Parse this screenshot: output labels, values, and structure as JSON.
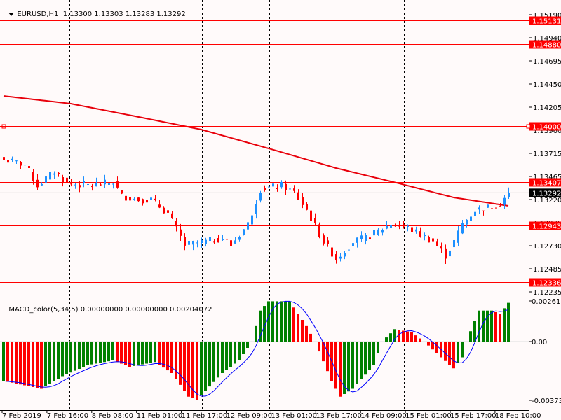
{
  "header": {
    "symbol": "EURUSD,H1",
    "open": "1.13300",
    "high": "1.13303",
    "low": "1.13283",
    "close": "1.13292"
  },
  "indicator": {
    "name": "MACD_color(5,34,5)",
    "v1": "0.00000000",
    "v2": "0.00000000",
    "v3": "0.00204072",
    "axis_top": "0.0026192",
    "axis_zero": "0.00",
    "axis_bottom": "-0.003734"
  },
  "price_axis": [
    "1.15190",
    "1.14940",
    "1.14695",
    "1.14450",
    "1.14205",
    "1.13960",
    "1.13715",
    "1.13465",
    "1.13220",
    "1.12975",
    "1.12730",
    "1.12485",
    "1.12235"
  ],
  "levels": [
    {
      "label": "1.15131",
      "value": 1.15131
    },
    {
      "label": "1.14880",
      "value": 1.1488
    },
    {
      "label": "1.14000",
      "value": 1.14
    },
    {
      "label": "1.13407",
      "value": 1.13407
    },
    {
      "label": "1.12943",
      "value": 1.12943
    },
    {
      "label": "1.12336",
      "value": 1.12336
    }
  ],
  "current_price": {
    "label": "1.13292",
    "value": 1.13292
  },
  "time_axis": [
    "7 Feb 2019",
    "7 Feb 16:00",
    "8 Feb 08:00",
    "11 Feb 01:00",
    "11 Feb 17:00",
    "12 Feb 09:00",
    "13 Feb 01:00",
    "13 Feb 17:00",
    "14 Feb 09:00",
    "15 Feb 01:00",
    "15 Feb 17:00",
    "18 Feb 10:00"
  ],
  "colors": {
    "bull": "#1e90ff",
    "bear": "#ff0000",
    "ma": "#e8000b",
    "level": "#ff0000",
    "macd_up": "#008000",
    "macd_down": "#ff0000",
    "signal": "#0000ff",
    "bg": "#fffafa"
  },
  "chart_data": {
    "type": "candlestick",
    "bars": 121,
    "price_range": [
      1.12235,
      1.1519
    ],
    "close_anchors": [
      [
        0,
        1.13645
      ],
      [
        5,
        1.13593
      ],
      [
        8,
        1.13369
      ],
      [
        12,
        1.13519
      ],
      [
        15,
        1.13392
      ],
      [
        21,
        1.13369
      ],
      [
        26,
        1.13407
      ],
      [
        28,
        1.13257
      ],
      [
        32,
        1.1322
      ],
      [
        35,
        1.1322
      ],
      [
        39,
        1.13071
      ],
      [
        43,
        1.12735
      ],
      [
        48,
        1.12772
      ],
      [
        52,
        1.1281
      ],
      [
        54,
        1.12735
      ],
      [
        58,
        1.12959
      ],
      [
        61,
        1.13332
      ],
      [
        66,
        1.13369
      ],
      [
        69,
        1.13295
      ],
      [
        72,
        1.13108
      ],
      [
        76,
        1.12772
      ],
      [
        79,
        1.12586
      ],
      [
        83,
        1.12772
      ],
      [
        86,
        1.1281
      ],
      [
        89,
        1.12884
      ],
      [
        92,
        1.12959
      ],
      [
        96,
        1.12921
      ],
      [
        99,
        1.12847
      ],
      [
        102,
        1.12772
      ],
      [
        105,
        1.12623
      ],
      [
        107,
        1.12772
      ],
      [
        109,
        1.12959
      ],
      [
        112,
        1.13108
      ],
      [
        116,
        1.13145
      ],
      [
        118,
        1.13183
      ],
      [
        120,
        1.13292
      ]
    ],
    "ma_anchors": [
      [
        0,
        1.14324
      ],
      [
        16,
        1.14242
      ],
      [
        33,
        1.14093
      ],
      [
        47,
        1.13966
      ],
      [
        63,
        1.13765
      ],
      [
        79,
        1.13556
      ],
      [
        94,
        1.13392
      ],
      [
        107,
        1.13242
      ],
      [
        120,
        1.13153
      ]
    ],
    "macd_range": [
      -0.003734,
      0.0026192
    ],
    "macd_anchors": [
      [
        0,
        -0.0025
      ],
      [
        9,
        -0.003
      ],
      [
        14,
        -0.0022
      ],
      [
        20,
        -0.0015
      ],
      [
        26,
        -0.0012
      ],
      [
        30,
        -0.0016
      ],
      [
        36,
        -0.0013
      ],
      [
        40,
        -0.002
      ],
      [
        44,
        -0.0035
      ],
      [
        46,
        -0.0037
      ],
      [
        52,
        -0.002
      ],
      [
        56,
        -0.0012
      ],
      [
        59,
        0.0
      ],
      [
        61,
        0.002
      ],
      [
        63,
        0.0026
      ],
      [
        68,
        0.0026
      ],
      [
        72,
        0.001
      ],
      [
        74,
        0.0
      ],
      [
        78,
        -0.0025
      ],
      [
        80,
        -0.0035
      ],
      [
        83,
        -0.003
      ],
      [
        88,
        -0.0015
      ],
      [
        90,
        0.0
      ],
      [
        93,
        0.0008
      ],
      [
        97,
        0.0006
      ],
      [
        100,
        0.0
      ],
      [
        104,
        -0.001
      ],
      [
        107,
        -0.0017
      ],
      [
        109,
        -0.001
      ],
      [
        110,
        0.0
      ],
      [
        113,
        0.002
      ],
      [
        116,
        0.002
      ],
      [
        118,
        0.0018
      ],
      [
        120,
        0.0025
      ]
    ]
  }
}
